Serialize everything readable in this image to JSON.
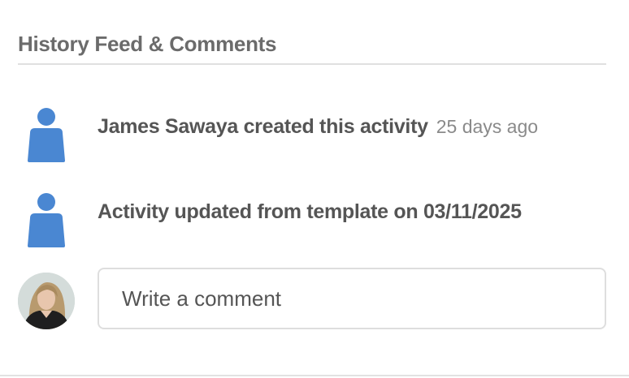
{
  "section": {
    "title": "History Feed & Comments"
  },
  "feed": [
    {
      "icon": "user-icon",
      "text": "James Sawaya created this activity",
      "time": "25 days ago"
    },
    {
      "icon": "user-icon",
      "text": "Activity updated from template on 03/11/2025",
      "time": ""
    }
  ],
  "comment": {
    "avatar": "user-avatar-photo",
    "placeholder": "Write a comment"
  },
  "colors": {
    "icon_blue": "#4a87d2",
    "title_gray": "#6b6b6b",
    "text_dark": "#555555",
    "time_gray": "#8a8a8a"
  }
}
